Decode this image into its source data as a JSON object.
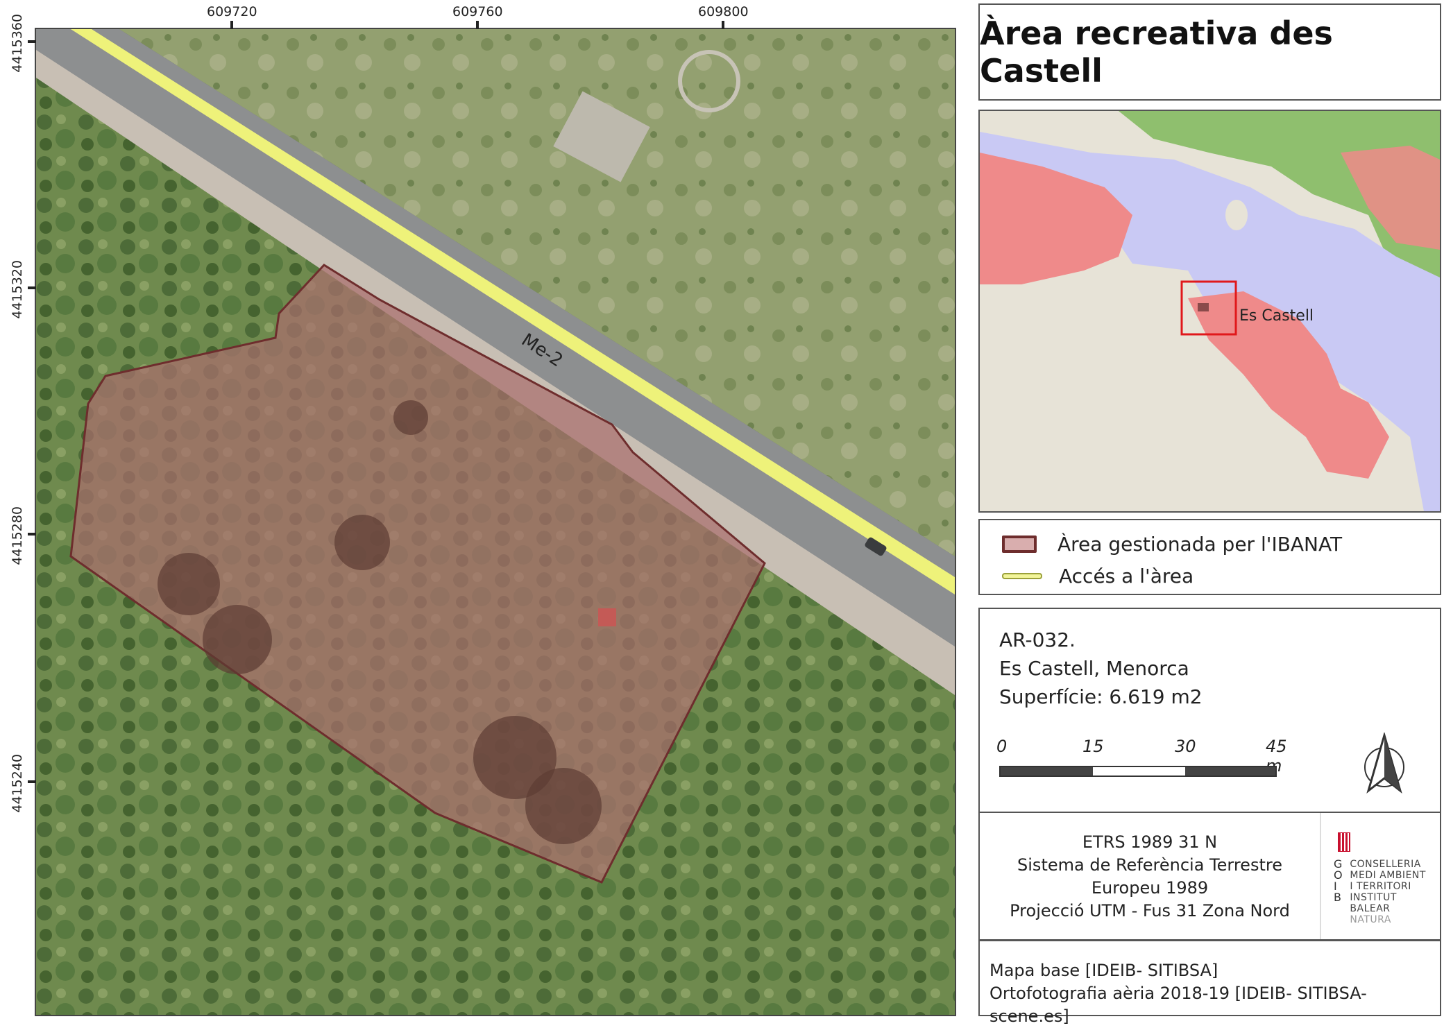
{
  "title": "Àrea recreativa des Castell",
  "map": {
    "road_label": "Me-2",
    "x_ticks": [
      "609720",
      "609760",
      "609800"
    ],
    "y_ticks": [
      "4415360",
      "4415320",
      "4415280",
      "4415240"
    ]
  },
  "locator": {
    "place_label": "Es Castell",
    "colors": {
      "water": "#c9c9f4",
      "urban": "#ef8a8a",
      "terrain": "#e7e3d7",
      "forest": "#8fbf6e",
      "highlight_box": "#e0181b"
    }
  },
  "legend": {
    "items": [
      {
        "label": "Àrea gestionada per l'IBANAT",
        "color": "#d9aeae",
        "border": "#6e2d2d"
      },
      {
        "label": "Accés a l'àrea",
        "color": "#f2f59a"
      }
    ]
  },
  "info": {
    "code": "AR-032.",
    "location": "Es Castell, Menorca",
    "surface": "Superfície: 6.619 m2"
  },
  "scalebar": {
    "labels": [
      "0",
      "15",
      "30",
      "45 m"
    ]
  },
  "north_arrow": {
    "icon": "north-arrow-icon"
  },
  "crs": {
    "lines": [
      "ETRS 1989 31 N",
      "Sistema de Referència Terrestre",
      "Europeu 1989",
      "Projecció UTM - Fus 31 Zona Nord"
    ]
  },
  "logo": {
    "letters": [
      "G",
      "O",
      "I",
      "B"
    ],
    "lines": [
      "CONSELLERIA",
      "MEDI AMBIENT",
      "I TERRITORI",
      "INSTITUT BALEAR",
      "NATURA"
    ]
  },
  "source": {
    "lines": [
      "Mapa base [IDEIB- SITIBSA]",
      "Ortofotografia aèria 2018-19 [IDEIB- SITIBSA-scene.es]"
    ]
  }
}
